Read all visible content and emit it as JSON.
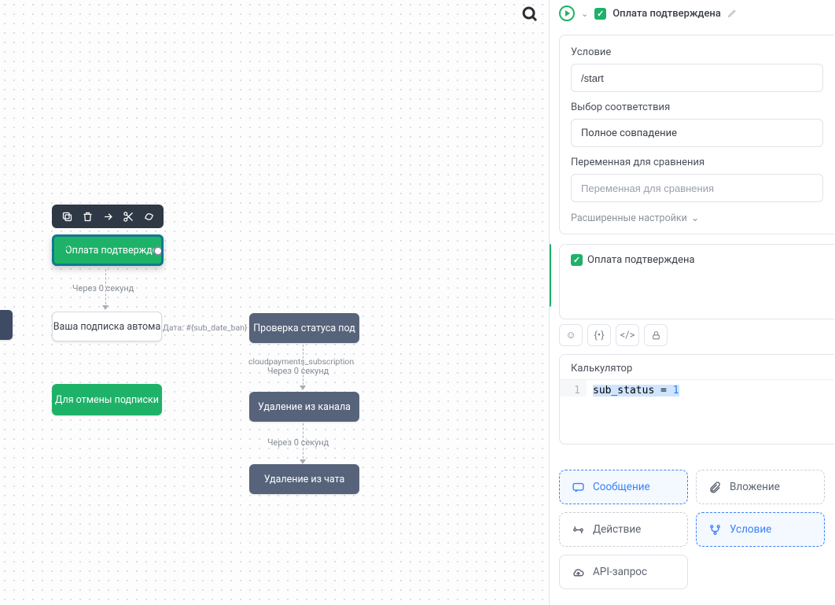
{
  "header": {
    "title": "Оплата подтверждена"
  },
  "condition": {
    "label": "Условие",
    "value": "/start",
    "match_label": "Выбор соответствия",
    "match_value": "Полное совпадение",
    "var_label": "Переменная для сравнения",
    "var_placeholder": "Переменная для сравнения",
    "advanced": "Расширенные настройки"
  },
  "message": {
    "text": "Оплата подтверждена"
  },
  "calculator": {
    "title": "Калькулятор",
    "line_number": "1",
    "code_prefix": "sub_status = ",
    "code_value": "1"
  },
  "actions": {
    "message": "Сообщение",
    "attachment": "Вложение",
    "action": "Действие",
    "condition": "Условие",
    "api": "API-запрос"
  },
  "canvas": {
    "selected_node": "Оплата подтвержде",
    "delay1": "Через 0 секунд",
    "sub_auto": "Ваша подписка автома",
    "date_hint": "Дата: #{sub_date_ban}",
    "check_status": "Проверка статуса под",
    "cp_label": "cloudpayments_subscription",
    "delay2": "Через 0 секунд",
    "cancel_sub": "Для отмены подписки",
    "remove_channel": "Удаление из канала",
    "delay3": "Через 0 секунд",
    "remove_chat": "Удаление из чата"
  }
}
